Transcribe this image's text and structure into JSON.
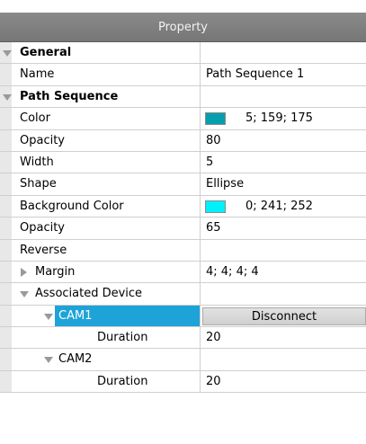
{
  "panel": {
    "title": "Property"
  },
  "rows": {
    "general": {
      "label": "General"
    },
    "name": {
      "label": "Name",
      "value": "Path Sequence 1"
    },
    "path_sequence": {
      "label": "Path Sequence"
    },
    "color": {
      "label": "Color",
      "value": "5; 159; 175",
      "swatch": "#059faf"
    },
    "opacity1": {
      "label": "Opacity",
      "value": "80"
    },
    "width": {
      "label": "Width",
      "value": "5"
    },
    "shape": {
      "label": "Shape",
      "value": "Ellipse"
    },
    "bg_color": {
      "label": "Background Color",
      "value": "0; 241; 252",
      "swatch": "#00f1fc"
    },
    "opacity2": {
      "label": "Opacity",
      "value": "65"
    },
    "reverse": {
      "label": "Reverse",
      "value": ""
    },
    "margin": {
      "label": "Margin",
      "value": "4; 4; 4; 4"
    },
    "associated_device": {
      "label": "Associated Device"
    },
    "cam1": {
      "label": "CAM1",
      "button": "Disconnect"
    },
    "cam1_duration": {
      "label": "Duration",
      "value": "20"
    },
    "cam2": {
      "label": "CAM2"
    },
    "cam2_duration": {
      "label": "Duration",
      "value": "20"
    }
  },
  "colors": {
    "selection": "#1ea3d8",
    "header": "#808080"
  },
  "icons": {
    "expanded": "triangle-down-icon",
    "collapsed": "triangle-right-icon"
  }
}
